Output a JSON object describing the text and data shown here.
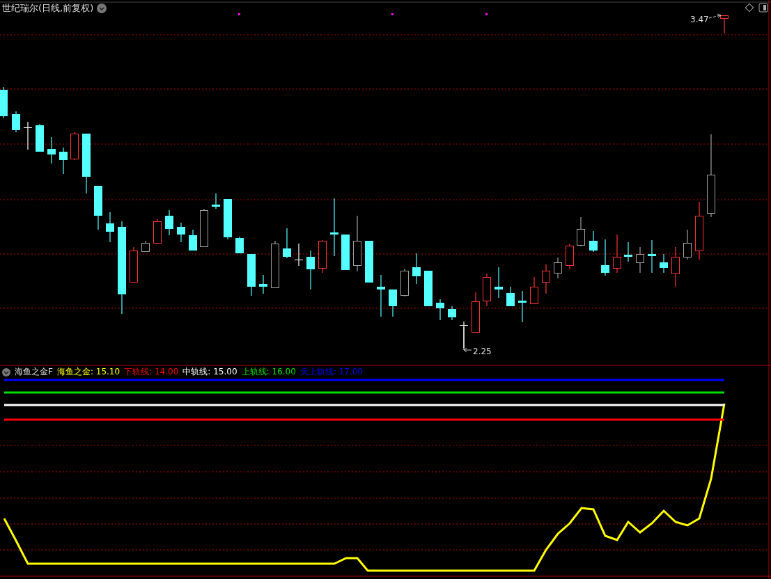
{
  "chart": {
    "title": "世纪瑞尔(日线,前复权)",
    "high_label": "3.47",
    "low_label": "2.25"
  },
  "indicator": {
    "name": "海鱼之金F",
    "values": [
      {
        "label": "海鱼之金:",
        "value": "15.10",
        "color": "#ffff00"
      },
      {
        "label": "下轨线:",
        "value": "14.00",
        "color": "#ff0000"
      },
      {
        "label": "中轨线:",
        "value": "15.00",
        "color": "#ffffff"
      },
      {
        "label": "上轨线:",
        "value": "16.00",
        "color": "#00e000"
      },
      {
        "label": "天上轨线:",
        "value": "17.00",
        "color": "#0000ff"
      }
    ]
  }
}
